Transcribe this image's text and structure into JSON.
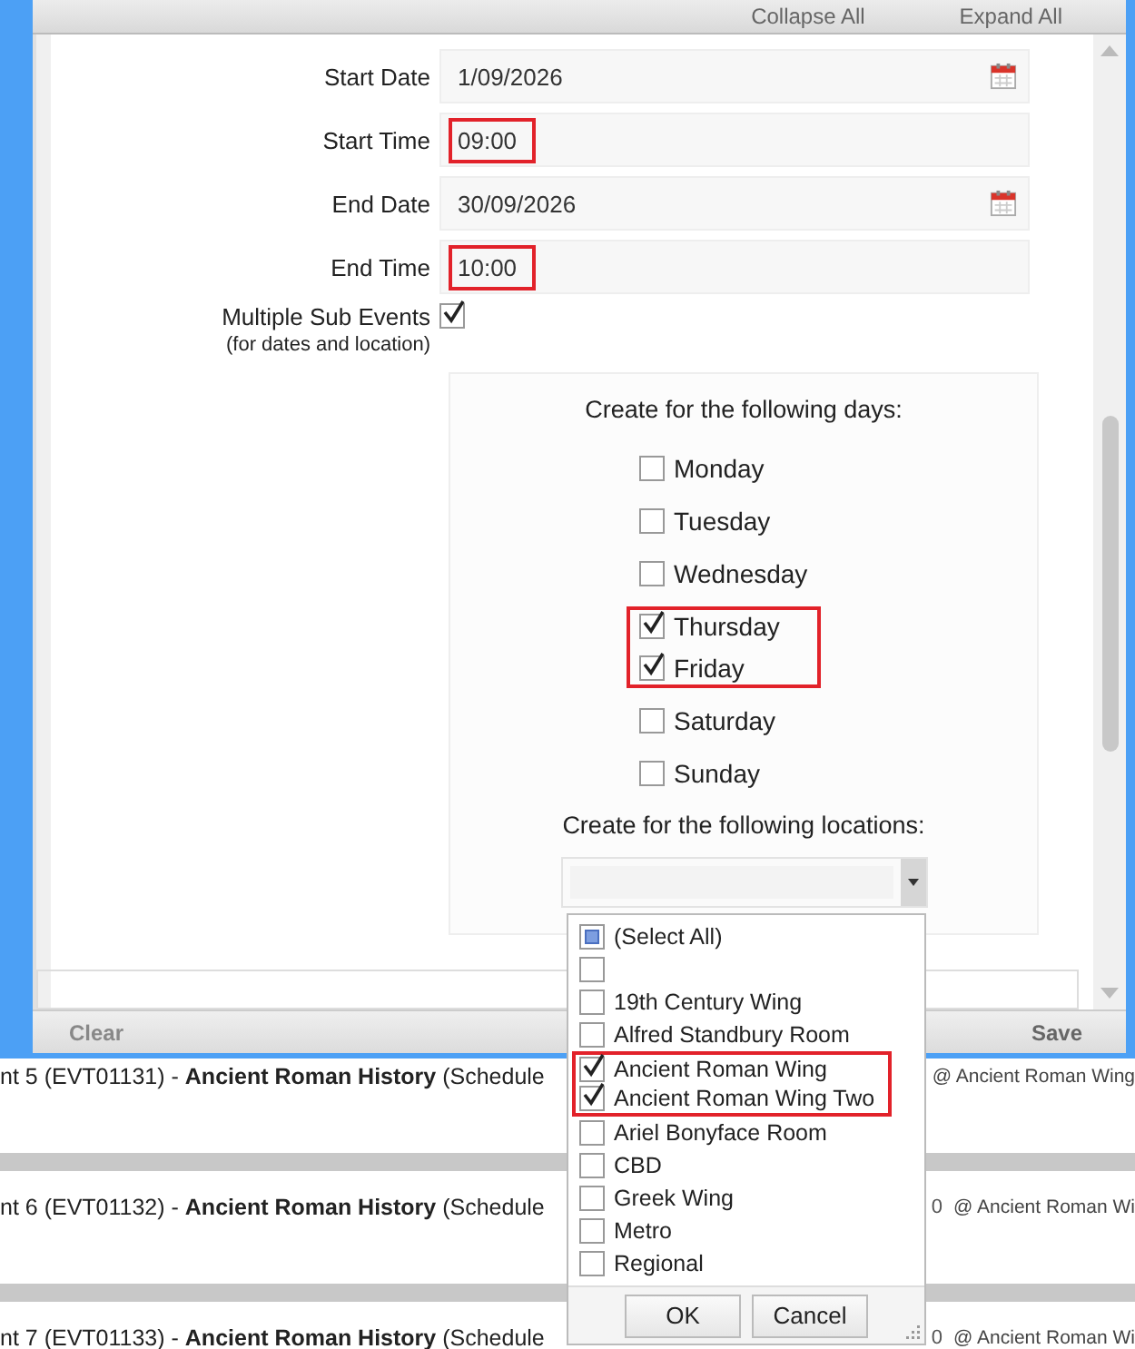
{
  "toolbar": {
    "buttons": [
      "Collapse All",
      "Expand All"
    ]
  },
  "fields": [
    {
      "label": "Start Date",
      "value": "1/09/2026",
      "kind": "date",
      "highlighted": false
    },
    {
      "label": "Start Time",
      "value": "09:00",
      "kind": "time",
      "highlighted": true
    },
    {
      "label": "End Date",
      "value": "30/09/2026",
      "kind": "date",
      "highlighted": false
    },
    {
      "label": "End Time",
      "value": "10:00",
      "kind": "time",
      "highlighted": true
    }
  ],
  "multiple_sub_events": {
    "label": "Multiple Sub Events",
    "note": "(for dates and location)",
    "checked": true
  },
  "days_heading": "Create for the following days:",
  "days": [
    {
      "label": "Monday",
      "checked": false,
      "highlighted": false
    },
    {
      "label": "Tuesday",
      "checked": false,
      "highlighted": false
    },
    {
      "label": "Wednesday",
      "checked": false,
      "highlighted": false
    },
    {
      "label": "Thursday",
      "checked": true,
      "highlighted": true
    },
    {
      "label": "Friday",
      "checked": true,
      "highlighted": true
    },
    {
      "label": "Saturday",
      "checked": false,
      "highlighted": false
    },
    {
      "label": "Sunday",
      "checked": false,
      "highlighted": false
    }
  ],
  "locations_heading": "Create for the following locations:",
  "locations_dropdown": {
    "expanded": true,
    "items": [
      {
        "label": "(Select All)",
        "kind": "select_all",
        "checked": false,
        "highlighted": false
      },
      {
        "kind": "item",
        "checked": false,
        "highlighted": false
      },
      {
        "label": "19th Century Wing",
        "kind": "item",
        "checked": false,
        "highlighted": false
      },
      {
        "label": "Alfred Standbury Room",
        "kind": "item",
        "checked": false,
        "highlighted": false
      },
      {
        "label": "Ancient Roman Wing",
        "kind": "item",
        "checked": true,
        "highlighted": true
      },
      {
        "label": "Ancient Roman Wing Two",
        "kind": "item",
        "checked": true,
        "highlighted": true
      },
      {
        "label": "Ariel Bonyface Room",
        "kind": "item",
        "checked": false,
        "highlighted": false
      },
      {
        "label": "CBD",
        "kind": "item",
        "checked": false,
        "highlighted": false
      },
      {
        "label": "Greek Wing",
        "kind": "item",
        "checked": false,
        "highlighted": false
      },
      {
        "label": "Metro",
        "kind": "item",
        "checked": false,
        "highlighted": false
      },
      {
        "label": "Regional",
        "kind": "item",
        "checked": false,
        "highlighted": false
      }
    ],
    "buttons": [
      "OK",
      "Cancel"
    ]
  },
  "footer": {
    "buttons": [
      "Clear",
      "Save"
    ]
  },
  "events": [
    {
      "title": "nt 5 (EVT01131) - **Ancient Roman History** (Schedule",
      "location": "@ Ancient Roman Wing"
    },
    {
      "title": "nt 6 (EVT01132) - **Ancient Roman History** (Schedule",
      "time_tail": "0",
      "location": "@ Ancient Roman Wi"
    },
    {
      "title": "nt 7 (EVT01133) - **Ancient Roman History** (Schedule",
      "time_tail": "0",
      "location": "@ Ancient Roman Wi"
    }
  ]
}
